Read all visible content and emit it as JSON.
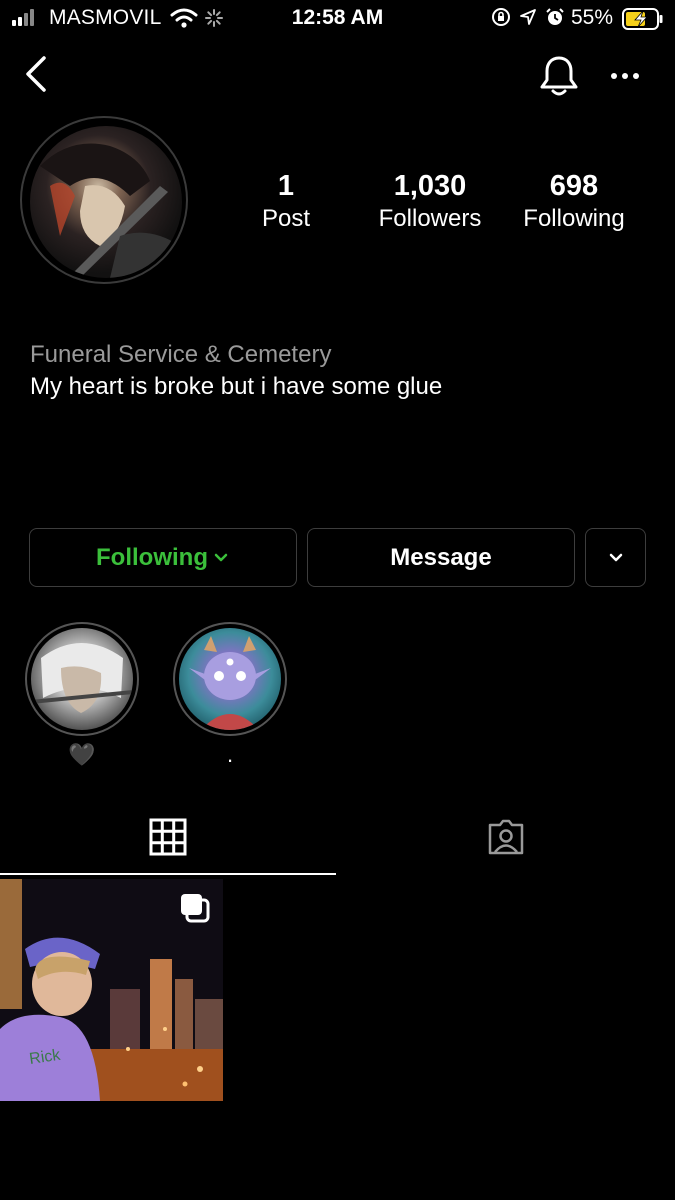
{
  "status_bar": {
    "carrier": "MASMOVIL",
    "time": "12:58 AM",
    "battery_percent": "55%"
  },
  "profile": {
    "posts_count": "1",
    "posts_label": "Post",
    "followers_count": "1,030",
    "followers_label": "Followers",
    "following_count": "698",
    "following_label": "Following",
    "category": "Funeral Service & Cemetery",
    "bio": "My heart is broke but i have some glue"
  },
  "actions": {
    "following_label": "Following",
    "message_label": "Message"
  },
  "highlights": [
    {
      "label": "🖤"
    },
    {
      "label": "."
    }
  ],
  "icons": {
    "back": "chevron-left-icon",
    "notifications": "bell-icon",
    "more": "more-horizontal-icon",
    "grid": "grid-icon",
    "tagged": "tagged-person-icon",
    "multiple": "carousel-icon"
  },
  "colors": {
    "background": "#000000",
    "following_accent": "#3bbf3b",
    "battery_charge": "#f5d01a"
  }
}
